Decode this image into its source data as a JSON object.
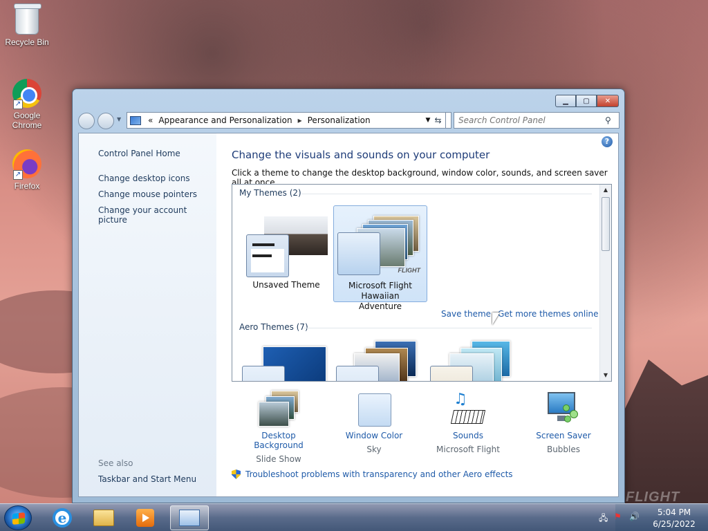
{
  "desktop": {
    "icons": [
      {
        "label": "Recycle Bin"
      },
      {
        "label": "Google Chrome"
      },
      {
        "label": "Firefox"
      }
    ],
    "watermark": "FLIGHT"
  },
  "window": {
    "address": {
      "overflow": "«",
      "crumbs": [
        "Appearance and Personalization",
        "Personalization"
      ]
    },
    "search_placeholder": "Search Control Panel",
    "left_pane": {
      "links": [
        "Control Panel Home",
        "Change desktop icons",
        "Change mouse pointers",
        "Change your account picture"
      ],
      "see_also_label": "See also",
      "see_also_links": [
        "Taskbar and Start Menu"
      ]
    },
    "heading": "Change the visuals and sounds on your computer",
    "subheading": "Click a theme to change the desktop background, window color, sounds, and screen saver all at once.",
    "themes": {
      "my_themes_title": "My Themes (2)",
      "my_themes": [
        {
          "name": "Unsaved Theme",
          "selected": false
        },
        {
          "name": "Microsoft Flight Hawaiian Adventure",
          "selected": true
        }
      ],
      "save_theme": "Save theme",
      "get_more": "Get more themes online",
      "aero_title": "Aero Themes (7)"
    },
    "options": [
      {
        "title": "Desktop Background",
        "value": "Slide Show"
      },
      {
        "title": "Window Color",
        "value": "Sky"
      },
      {
        "title": "Sounds",
        "value": "Microsoft Flight"
      },
      {
        "title": "Screen Saver",
        "value": "Bubbles"
      }
    ],
    "troubleshoot": "Troubleshoot problems with transparency and other Aero effects"
  },
  "taskbar": {
    "time": "5:04 PM",
    "date": "6/25/2022"
  },
  "colors": {
    "link": "#1e5aa8",
    "heading": "#1e3c78",
    "selection": "#cfe3f8"
  }
}
